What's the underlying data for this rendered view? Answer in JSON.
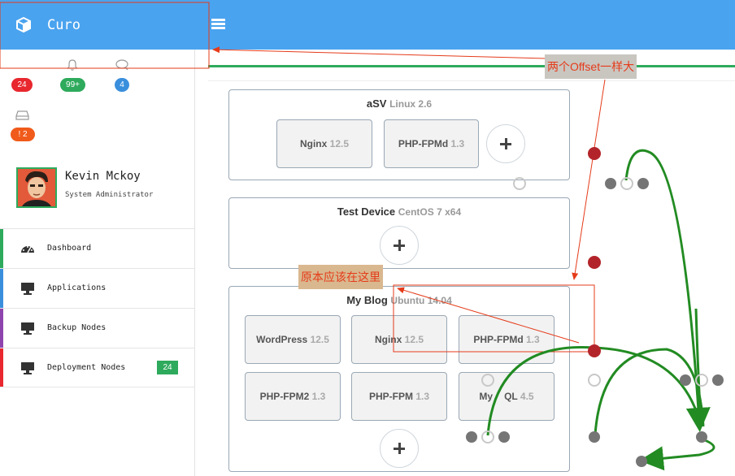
{
  "brand": {
    "title": "Curo",
    "logo_icon": "cube-icon",
    "color": "#4aa3ef"
  },
  "notifications": {
    "alerts": {
      "icon": "bell-icon",
      "count": "24",
      "color": "#e8272e"
    },
    "bell": {
      "icon": "bell-icon",
      "count": "99+",
      "color": "#2eaa5c"
    },
    "messages": {
      "icon": "chat-icon",
      "count": "4",
      "color": "#3a8fdd"
    },
    "storage": {
      "icon": "hdd-icon",
      "count": "! 2",
      "color": "#f05a1a"
    }
  },
  "profile": {
    "name": "Kevin Mckoy",
    "role": "System Administrator"
  },
  "menu": [
    {
      "label": "Dashboard",
      "icon": "dashboard-icon",
      "color": "#2eaa5c"
    },
    {
      "label": "Applications",
      "icon": "monitor-icon",
      "color": "#3a8fdd"
    },
    {
      "label": "Backup Nodes",
      "icon": "monitor-icon",
      "color": "#8e44ad"
    },
    {
      "label": "Deployment Nodes",
      "icon": "monitor-icon",
      "color": "#e8272e",
      "count": "24"
    }
  ],
  "devices": [
    {
      "name": "aSV",
      "os": "Linux 2.6",
      "services": [
        {
          "name": "Nginx",
          "ver": "12.5"
        },
        {
          "name": "PHP-FPMd",
          "ver": "1.3"
        }
      ]
    },
    {
      "name": "Test Device",
      "os": "CentOS 7 x64",
      "services": []
    },
    {
      "name": "My Blog",
      "os": "Ubuntu 14.04",
      "services": [
        {
          "name": "WordPress",
          "ver": "12.5"
        },
        {
          "name": "Nginx",
          "ver": "12.5"
        },
        {
          "name": "PHP-FPMd",
          "ver": "1.3"
        },
        {
          "name": "PHP-FPM2",
          "ver": "1.3"
        },
        {
          "name": "PHP-FPM",
          "ver": "1.3"
        },
        {
          "name": "My",
          "name2": "QL",
          "ver": "4.5"
        }
      ]
    }
  ],
  "annotations": {
    "offset_note": "两个Offset一样大",
    "original_note": "原本应该在这里"
  }
}
